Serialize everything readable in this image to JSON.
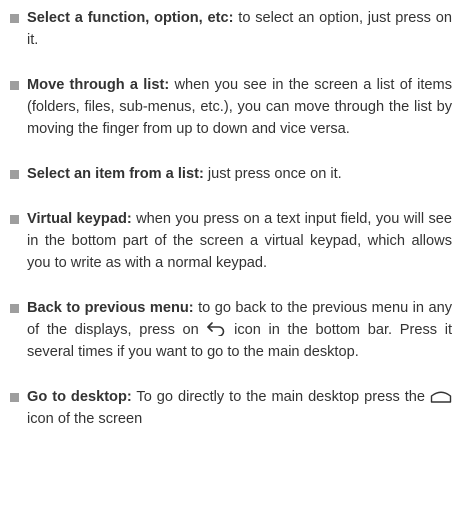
{
  "items": [
    {
      "term": "Select a function, option, etc:",
      "text": " to select an option, just press on it."
    },
    {
      "term": "Move through a list:",
      "text": " when you see in the screen a list of items (folders, files, sub-menus, etc.), you can move through the list by moving the finger from up to down and vice versa."
    },
    {
      "term": "Select an item from a list:",
      "text": " just press once on it."
    },
    {
      "term": "Virtual keypad:",
      "text": " when you press on a text input field, you will see in the bottom part of the screen a virtual keypad, which allows you to write as with a normal keypad."
    },
    {
      "term": "Back to previous menu:",
      "text_before": " to go back to the previous menu in any of the displays, press on ",
      "icon": "back-arrow-icon",
      "text_after": " icon in the bottom bar. Press it several times if you want to go to the main desktop."
    },
    {
      "term": "Go to desktop:",
      "text_before": " To go directly to the main desktop press the ",
      "icon": "home-icon",
      "text_after": " icon of the screen"
    }
  ],
  "colors": {
    "bullet": "#9e9e9e",
    "text": "#333333"
  }
}
